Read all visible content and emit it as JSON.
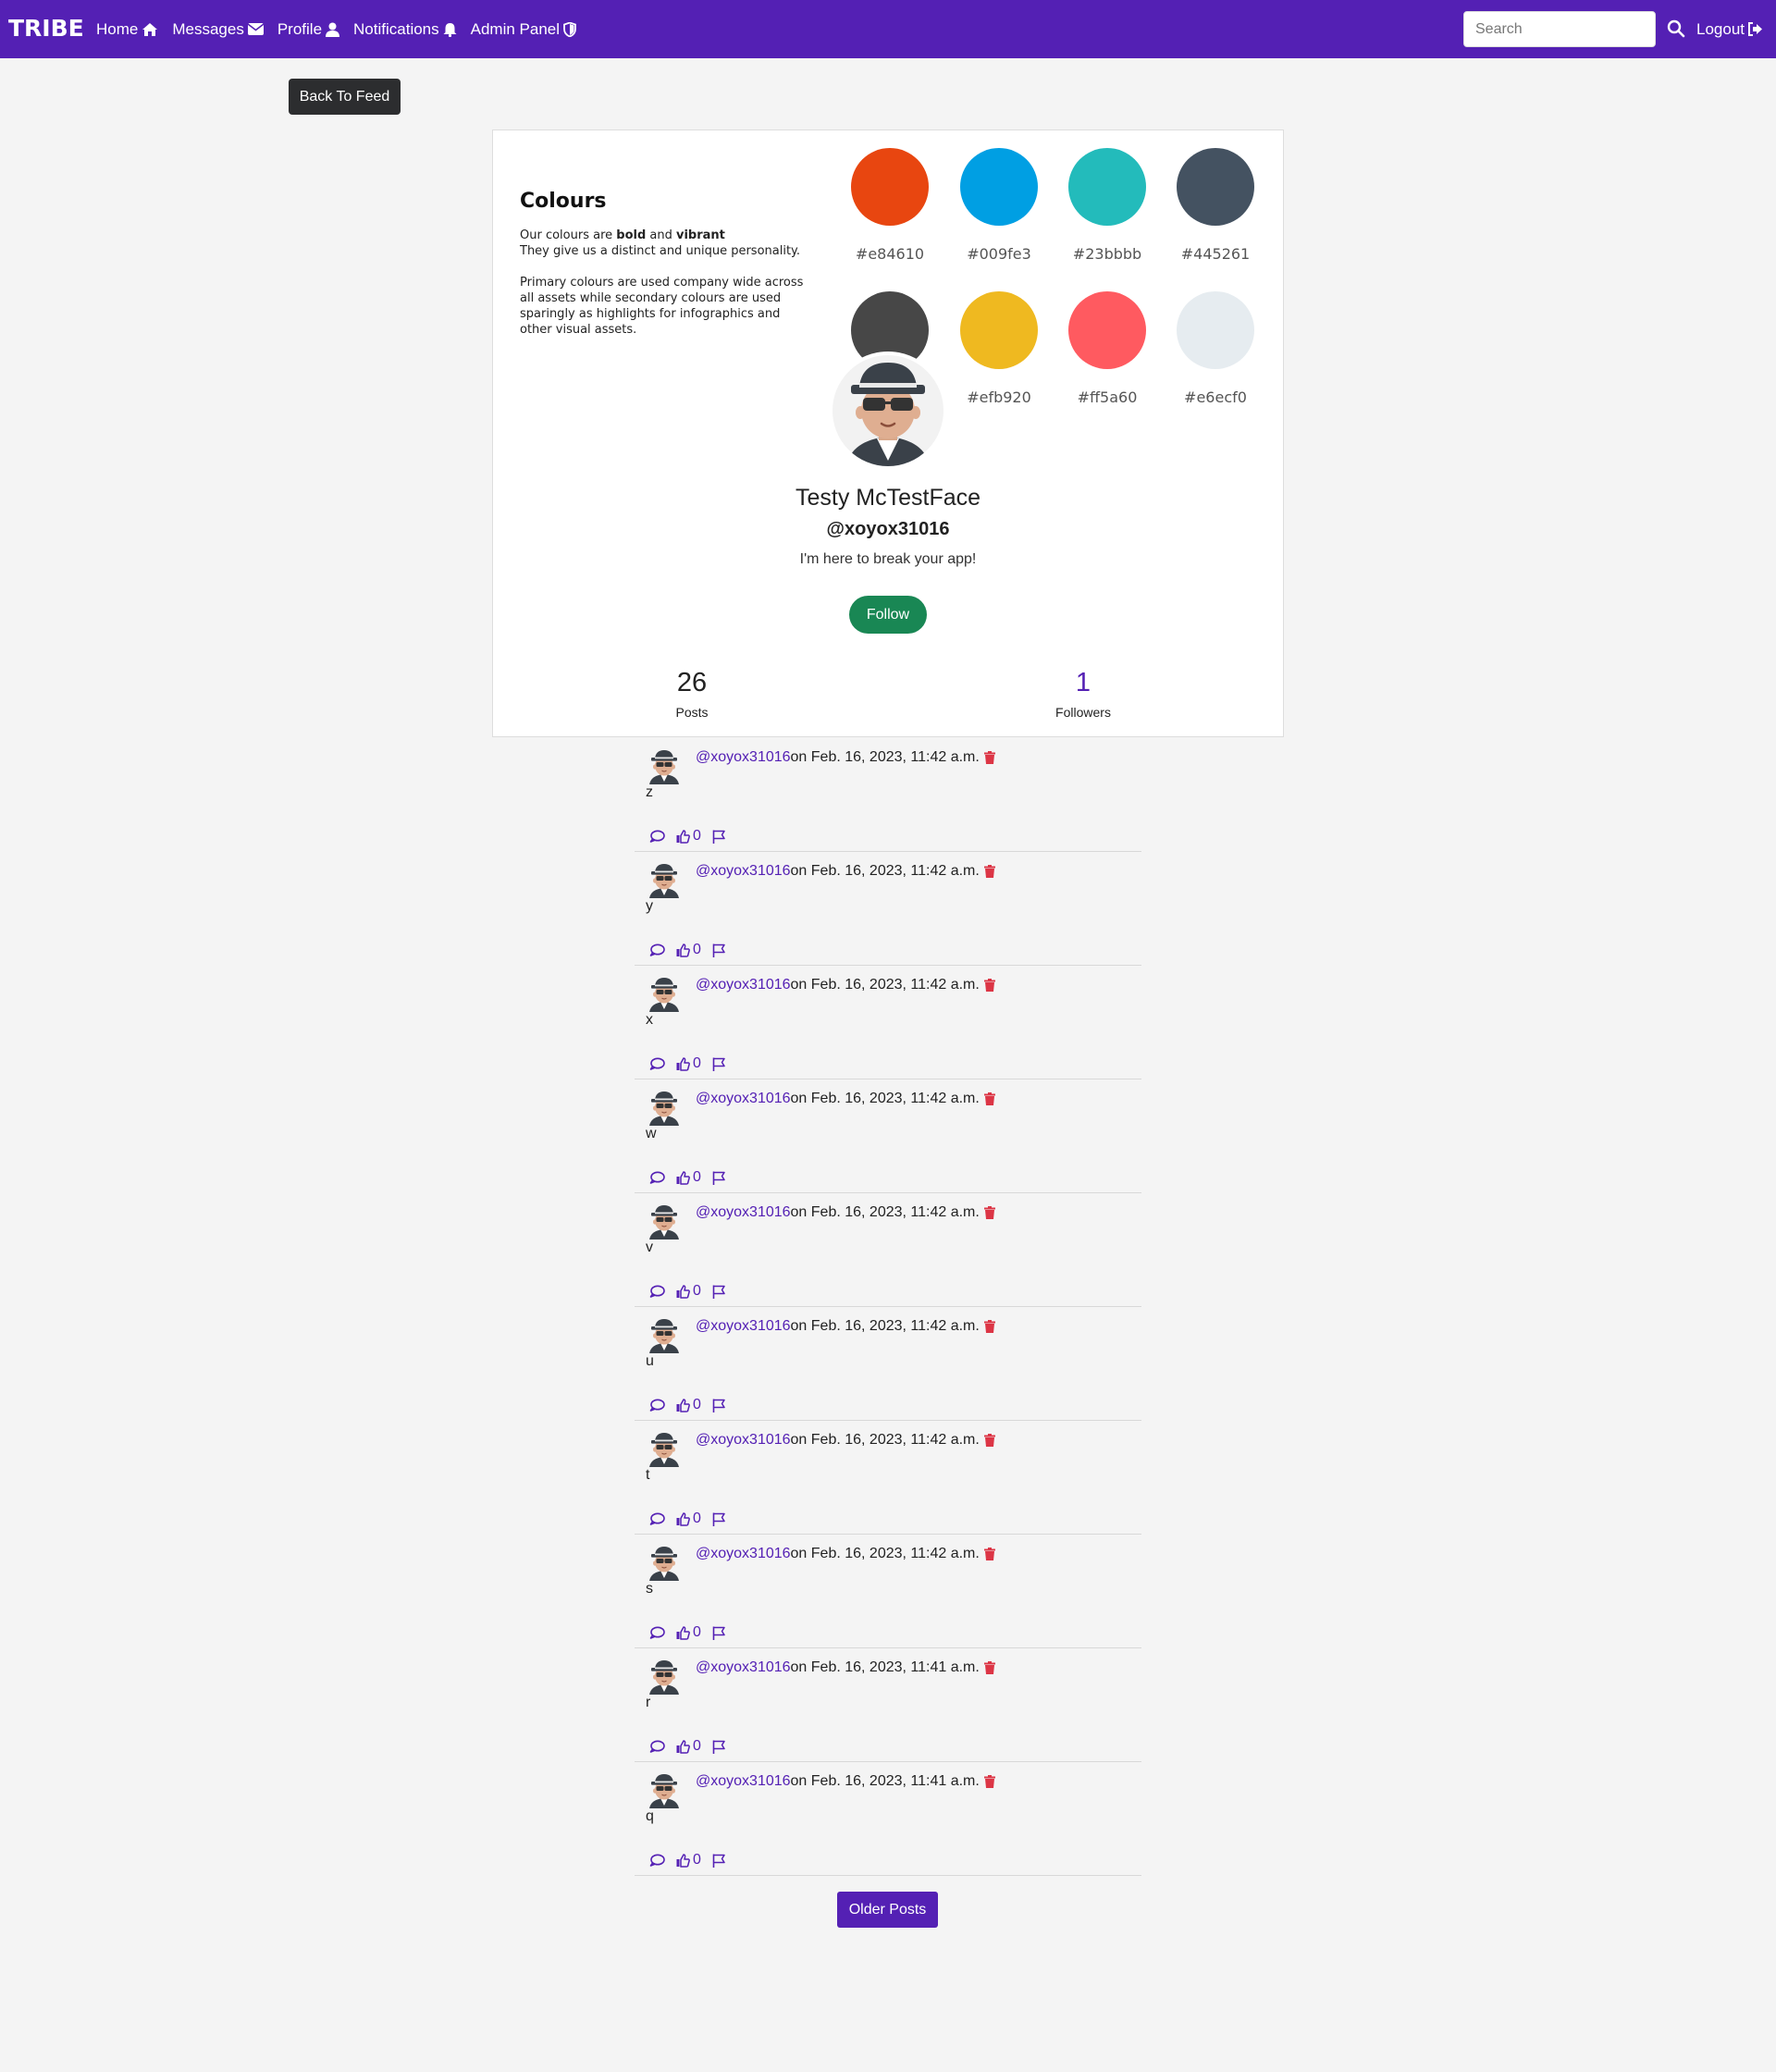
{
  "nav": {
    "brand": "TRIBE",
    "links": [
      {
        "label": "Home",
        "icon": "home-icon"
      },
      {
        "label": "Messages",
        "icon": "envelope-icon"
      },
      {
        "label": "Profile",
        "icon": "user-icon"
      },
      {
        "label": "Notifications",
        "icon": "bell-icon"
      },
      {
        "label": "Admin Panel",
        "icon": "shield-icon"
      }
    ],
    "search_placeholder": "Search",
    "logout_label": "Logout"
  },
  "back_button": "Back To Feed",
  "banner": {
    "title": "Colours",
    "intro_prefix": "Our colours are ",
    "intro_bold1": "bold",
    "intro_and": " and ",
    "intro_bold2": "vibrant",
    "intro_line2": "They give us a distinct and unique personality.",
    "paragraph2": "Primary colours are used company wide across all assets while secondary colours are used sparingly as highlights for infographics and other visual assets.",
    "swatches": [
      {
        "hex": "#e84610",
        "label": "#e84610"
      },
      {
        "hex": "#009fe3",
        "label": "#009fe3"
      },
      {
        "hex": "#23bbbb",
        "label": "#23bbbb"
      },
      {
        "hex": "#445261",
        "label": "#445261"
      },
      {
        "hex": "#474747",
        "label": ""
      },
      {
        "hex": "#efb920",
        "label": "#efb920"
      },
      {
        "hex": "#ff5a60",
        "label": "#ff5a60"
      },
      {
        "hex": "#e6ecf0",
        "label": "#e6ecf0"
      }
    ]
  },
  "profile": {
    "name": "Testy McTestFace",
    "handle": "@xoyox31016",
    "bio": "I'm here to break your app!",
    "follow_label": "Follow",
    "posts_count": "26",
    "posts_label": "Posts",
    "followers_count": "1",
    "followers_label": "Followers"
  },
  "posts": [
    {
      "user": "@xoyox31016",
      "date": " on Feb. 16, 2023, 11:42 a.m.",
      "body": "z",
      "likes": "0"
    },
    {
      "user": "@xoyox31016",
      "date": " on Feb. 16, 2023, 11:42 a.m.",
      "body": "y",
      "likes": "0"
    },
    {
      "user": "@xoyox31016",
      "date": " on Feb. 16, 2023, 11:42 a.m.",
      "body": "x",
      "likes": "0"
    },
    {
      "user": "@xoyox31016",
      "date": " on Feb. 16, 2023, 11:42 a.m.",
      "body": "w",
      "likes": "0"
    },
    {
      "user": "@xoyox31016",
      "date": " on Feb. 16, 2023, 11:42 a.m.",
      "body": "v",
      "likes": "0"
    },
    {
      "user": "@xoyox31016",
      "date": " on Feb. 16, 2023, 11:42 a.m.",
      "body": "u",
      "likes": "0"
    },
    {
      "user": "@xoyox31016",
      "date": " on Feb. 16, 2023, 11:42 a.m.",
      "body": "t",
      "likes": "0"
    },
    {
      "user": "@xoyox31016",
      "date": " on Feb. 16, 2023, 11:42 a.m.",
      "body": "s",
      "likes": "0"
    },
    {
      "user": "@xoyox31016",
      "date": " on Feb. 16, 2023, 11:41 a.m.",
      "body": "r",
      "likes": "0"
    },
    {
      "user": "@xoyox31016",
      "date": " on Feb. 16, 2023, 11:41 a.m.",
      "body": "q",
      "likes": "0"
    }
  ],
  "older_posts_label": "Older Posts",
  "colors": {
    "brand": "#5420b4",
    "follow": "#198754",
    "delete": "#dc3545",
    "back_button": "#2c2d2f"
  }
}
